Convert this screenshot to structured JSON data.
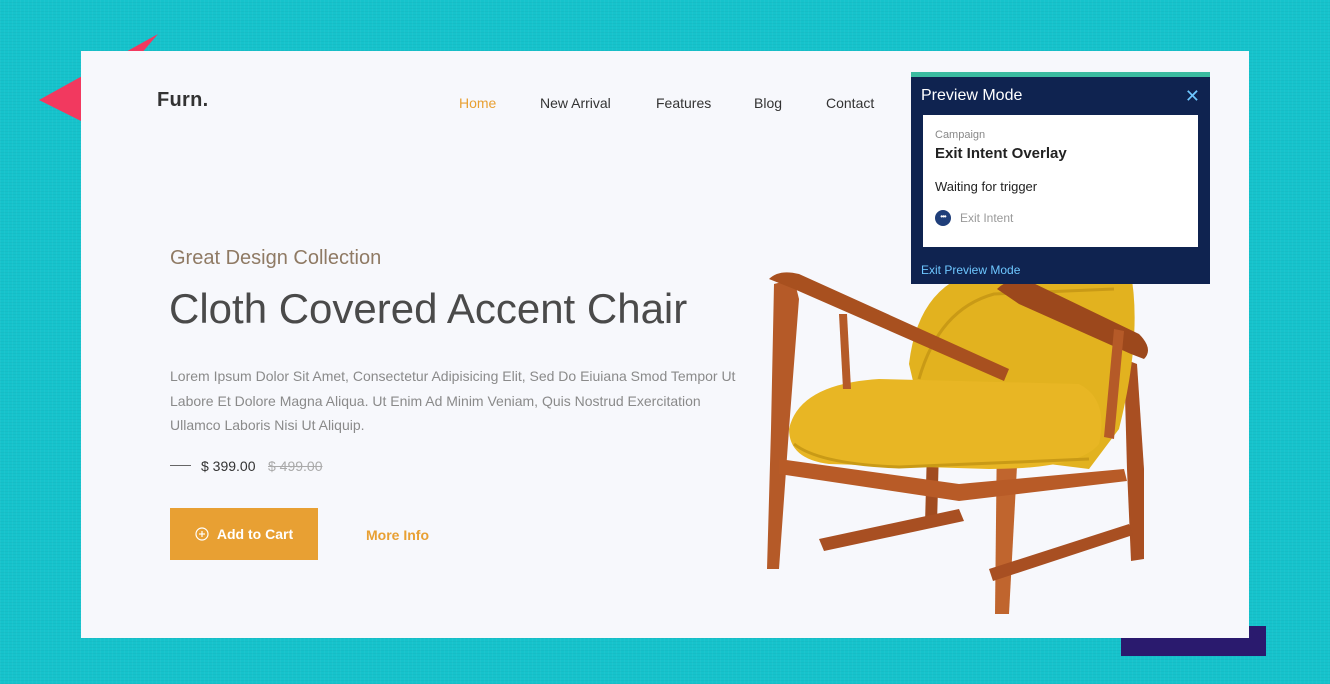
{
  "colors": {
    "page_bg": "#16c3cc",
    "card_bg": "#f7f8fc",
    "accent": "#e8a033",
    "preview_bg": "#0f2350",
    "preview_accent": "#3bbba0",
    "link": "#6ec7ff"
  },
  "header": {
    "logo": "Furn.",
    "nav": [
      {
        "label": "Home",
        "active": true
      },
      {
        "label": "New Arrival"
      },
      {
        "label": "Features"
      },
      {
        "label": "Blog"
      },
      {
        "label": "Contact"
      }
    ]
  },
  "hero": {
    "subtitle": "Great Design Collection",
    "title": "Cloth Covered Accent Chair",
    "description": "Lorem Ipsum Dolor Sit Amet, Consectetur Adipisicing Elit, Sed Do Eiuiana Smod Tempor Ut Labore Et Dolore Magna Aliqua. Ut Enim Ad Minim Veniam, Quis Nostrud Exercitation Ullamco Laboris Nisi Ut Aliquip.",
    "price": "$ 399.00",
    "old_price": "$ 499.00",
    "add_to_cart_label": "Add to Cart",
    "add_to_cart_icon": "plus-circle-icon",
    "more_info_label": "More Info"
  },
  "preview": {
    "title": "Preview Mode",
    "close_icon": "close-icon",
    "campaign_label": "Campaign",
    "campaign_name": "Exit Intent Overlay",
    "status": "Waiting for trigger",
    "trigger_icon": "more-dots-icon",
    "trigger": "Exit Intent",
    "exit_label": "Exit Preview Mode"
  }
}
